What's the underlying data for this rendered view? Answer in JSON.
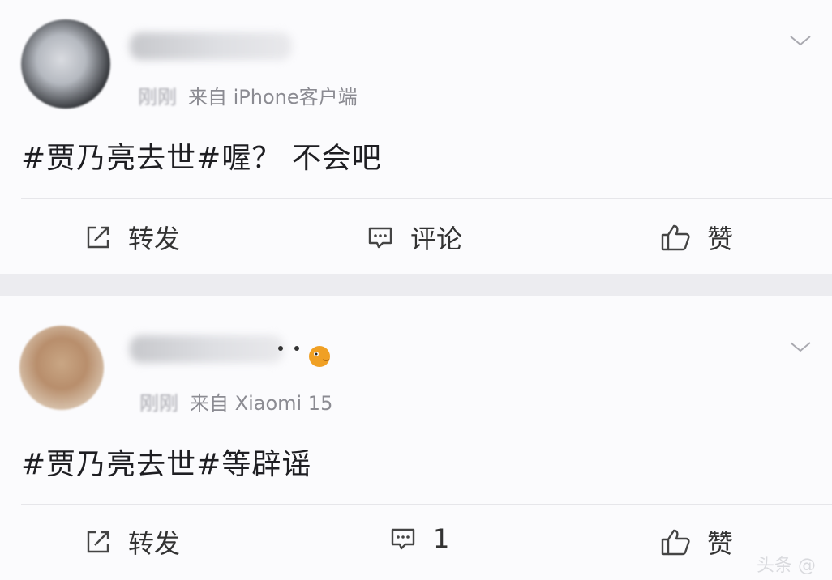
{
  "posts": [
    {
      "source": "来自 iPhone客户端",
      "time_blurred": "刚刚",
      "text": "#贾乃亮去世#喔？ 不会吧",
      "actions": {
        "repost": "转发",
        "comment": "评论",
        "like": "赞"
      }
    },
    {
      "source": "来自 Xiaomi 15",
      "time_blurred": "刚刚",
      "text": "#贾乃亮去世#等辟谣",
      "actions": {
        "repost": "转发",
        "comment": "1",
        "like": "赞"
      }
    }
  ],
  "watermark": "头条 @",
  "icons": {
    "repost": "repost-icon",
    "comment": "comment-icon",
    "like": "thumbs-up-icon",
    "menu": "chevron-down-icon"
  }
}
